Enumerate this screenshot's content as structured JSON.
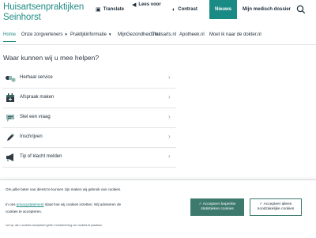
{
  "header": {
    "title_line1": "Huisartsenpraktijken",
    "title_line2": "Seinhorst",
    "translate_label": "Translate",
    "readspeaker_label": "Lees voor",
    "contrast_label": "Contrast",
    "nieuws_label": "Nieuws",
    "dossier_label": "Mijn medisch dossier",
    "accent_color": "#1f8c84"
  },
  "nav": {
    "items": [
      {
        "label": "Home"
      },
      {
        "label": "Onze zorgverleners"
      },
      {
        "label": "Praktijkinformatie"
      },
      {
        "label": "MijnGezondheid.net"
      },
      {
        "label": "Thuisarts.nl"
      },
      {
        "label": "Apotheek.nl"
      },
      {
        "label": "Moet ik naar de dokter.nl"
      }
    ]
  },
  "main": {
    "heading": "Waar kunnen wij u mee helpen?",
    "services": [
      {
        "label": "Herhaal service",
        "icon": "pills-icon"
      },
      {
        "label": "Afspraak maken",
        "icon": "calendar-icon"
      },
      {
        "label": "Stel een vraag",
        "icon": "chat-icon"
      },
      {
        "label": "Inschrijven",
        "icon": "pen-icon"
      },
      {
        "label": "Tip of klacht melden",
        "icon": "megaphone-icon"
      }
    ]
  },
  "cookie": {
    "line1": "Om jullie beter van dienst te kunnen zijn maken wij gebruik van cookies.",
    "line2_a": "In ons",
    "line2_link": "privacystatement",
    "line2_b": "staat hoe wij cookies inzetten. Wij adviseren de",
    "line2_c": "cookies te accepteren.",
    "line3": "Let op: als u cookies accepteert geeft u toestemming om cookies te plaatsen.",
    "accept_stats": "Accepteer beperkte statistieken cookies",
    "accept_needed": "Accepteer alleen noodzakelijke cookies",
    "button_color": "#3d7a6d"
  }
}
